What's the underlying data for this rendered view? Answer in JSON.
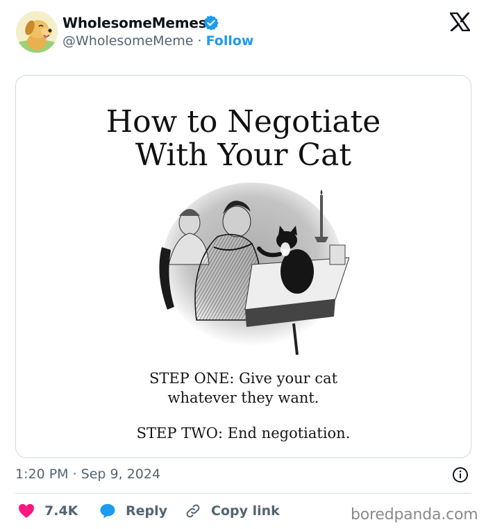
{
  "author": {
    "name": "WholesomeMemes",
    "handle": "@WholesomeMeme",
    "separator": " · ",
    "follow_label": "Follow",
    "verified_icon": "verified-badge-icon",
    "avatar_icon": "dog-avatar-icon"
  },
  "platform_icon": "x-logo-icon",
  "meme": {
    "title_line1": "How to Negotiate",
    "title_line2": "With Your Cat",
    "step_one_line1": "STEP ONE: Give your cat",
    "step_one_line2": "whatever they want.",
    "step_two": "STEP TWO: End negotiation.",
    "illustration": "engraving-man-and-cat-at-table"
  },
  "timestamp": "1:20 PM · Sep 9, 2024",
  "actions": {
    "like_count": "7.4K",
    "reply_label": "Reply",
    "copy_link_label": "Copy link"
  },
  "watermark": "boredpanda.com",
  "colors": {
    "accent": "#1d9bf0",
    "like": "#f91880",
    "text_secondary": "#536471",
    "border": "#cfd9de"
  }
}
